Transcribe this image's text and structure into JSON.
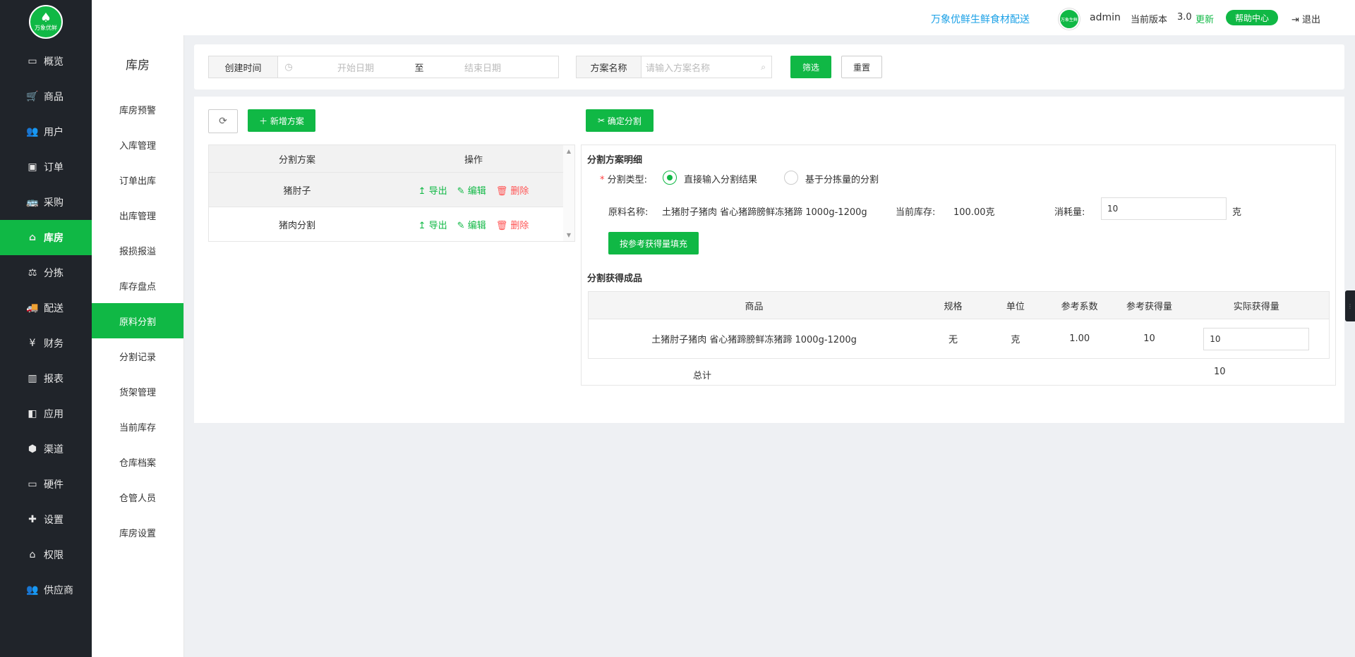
{
  "brand": {
    "logo_text": "万象优鲜"
  },
  "nav": [
    {
      "label": "概览",
      "icon": "monitor-icon",
      "glyph": "▭"
    },
    {
      "label": "商品",
      "icon": "cart-icon",
      "glyph": "🛒"
    },
    {
      "label": "用户",
      "icon": "users-icon",
      "glyph": "👥"
    },
    {
      "label": "订单",
      "icon": "money-icon",
      "glyph": "▣"
    },
    {
      "label": "采购",
      "icon": "bus-icon",
      "glyph": "🚌"
    },
    {
      "label": "库房",
      "icon": "home-icon",
      "glyph": "⌂",
      "active": true
    },
    {
      "label": "分拣",
      "icon": "scale-icon",
      "glyph": "⚖"
    },
    {
      "label": "配送",
      "icon": "truck-icon",
      "glyph": "🚚"
    },
    {
      "label": "财务",
      "icon": "yen-icon",
      "glyph": "¥"
    },
    {
      "label": "报表",
      "icon": "bar-chart-icon",
      "glyph": "▥"
    },
    {
      "label": "应用",
      "icon": "apps-icon",
      "glyph": "◧"
    },
    {
      "label": "渠道",
      "icon": "cube-icon",
      "glyph": "⬢"
    },
    {
      "label": "硬件",
      "icon": "desktop-icon",
      "glyph": "▭"
    },
    {
      "label": "设置",
      "icon": "puzzle-icon",
      "glyph": "✚"
    },
    {
      "label": "权限",
      "icon": "bank-icon",
      "glyph": "⌂"
    },
    {
      "label": "供应商",
      "icon": "users-icon",
      "glyph": "👥"
    }
  ],
  "subnav": {
    "title": "库房",
    "items": [
      "库房预警",
      "入库管理",
      "订单出库",
      "出库管理",
      "报损报溢",
      "库存盘点",
      "原料分割",
      "分割记录",
      "货架管理",
      "当前库存",
      "仓库档案",
      "仓管人员",
      "库房设置"
    ],
    "active_index": 6
  },
  "header": {
    "brand": "万象优鲜生鲜食材配送",
    "avatar_text": "万象生鲜",
    "user": "admin",
    "version_label": "当前版本",
    "version": "3.0",
    "update": "更新",
    "help": "帮助中心",
    "logout": "退出"
  },
  "filter": {
    "date_label": "创建时间",
    "start_placeholder": "开始日期",
    "to": "至",
    "end_placeholder": "结束日期",
    "plan_label": "方案名称",
    "plan_placeholder": "请输入方案名称",
    "search": "筛选",
    "reset": "重置"
  },
  "toolbar": {
    "add": "新增方案",
    "confirm_split": "确定分割"
  },
  "plan_table": {
    "headers": [
      "分割方案",
      "操作"
    ],
    "actions": {
      "export": "导出",
      "edit": "编辑",
      "delete": "删除"
    },
    "rows": [
      {
        "name": "猪肘子"
      },
      {
        "name": "猪肉分割"
      }
    ]
  },
  "detail": {
    "title": "分割方案明细",
    "type_label": "分割类型:",
    "option_direct": "直接输入分割结果",
    "option_sorted": "基于分拣量的分割",
    "material_label": "原料名称:",
    "material": "土猪肘子猪肉 省心猪蹄膀鲜冻猪蹄 1000g-1200g",
    "stock_label": "当前库存:",
    "stock": "100.00克",
    "consume_label": "消耗量:",
    "consume_value": "10",
    "consume_unit": "克",
    "fill_button": "按参考获得量填充",
    "result_title": "分割获得成品",
    "result_headers": [
      "商品",
      "规格",
      "单位",
      "参考系数",
      "参考获得量",
      "实际获得量"
    ],
    "result_rows": [
      {
        "product": "土猪肘子猪肉 省心猪蹄膀鲜冻猪蹄 1000g-1200g",
        "spec": "无",
        "unit": "克",
        "coef": "1.00",
        "ref": "10",
        "actual": "10"
      }
    ],
    "total_label": "总计",
    "total_value": "10"
  }
}
